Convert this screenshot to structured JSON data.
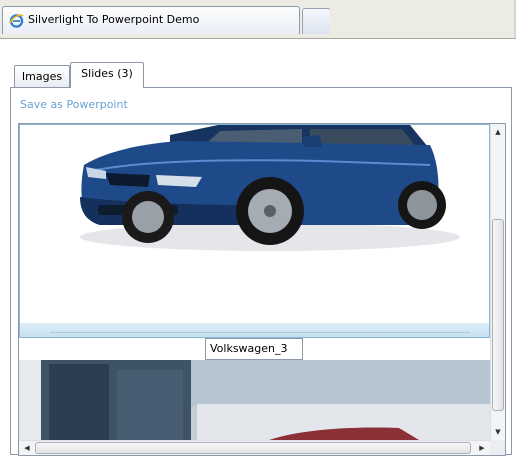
{
  "browser": {
    "tab_title": "Silverlight To Powerpoint Demo"
  },
  "tabs": [
    {
      "label": "Images",
      "selected": false
    },
    {
      "label": "Slides (3)",
      "selected": true
    }
  ],
  "actions": {
    "save_label": "Save as Powerpoint"
  },
  "slides": {
    "selected_caption": "Volkswagen_3"
  },
  "colors": {
    "link": "#6aa1d6",
    "selection_border": "#85b9d6",
    "car_body": "#1f4a8a"
  },
  "icons": {
    "browser_icon": "ie-logo-icon",
    "scroll_up": "arrow-up-icon",
    "scroll_down": "arrow-down-icon",
    "scroll_left": "arrow-left-icon",
    "scroll_right": "arrow-right-icon"
  }
}
